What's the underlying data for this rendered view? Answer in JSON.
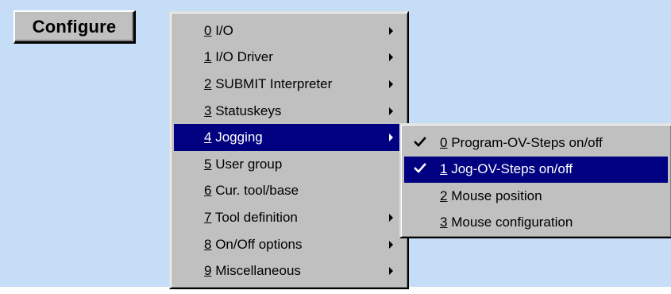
{
  "configure_button": {
    "label": "Configure"
  },
  "main_menu": {
    "items": [
      {
        "key": "0",
        "label": "I/O",
        "submenu": true
      },
      {
        "key": "1",
        "label": "I/O Driver",
        "submenu": true
      },
      {
        "key": "2",
        "label": "SUBMIT Interpreter",
        "submenu": true
      },
      {
        "key": "3",
        "label": "Statuskeys",
        "submenu": true
      },
      {
        "key": "4",
        "label": "Jogging",
        "submenu": true,
        "highlighted": true
      },
      {
        "key": "5",
        "label": "User group",
        "submenu": false
      },
      {
        "key": "6",
        "label": "Cur. tool/base",
        "submenu": false
      },
      {
        "key": "7",
        "label": "Tool definition",
        "submenu": true
      },
      {
        "key": "8",
        "label": "On/Off options",
        "submenu": true
      },
      {
        "key": "9",
        "label": "Miscellaneous",
        "submenu": true
      }
    ]
  },
  "jogging_submenu": {
    "items": [
      {
        "key": "0",
        "label": "Program-OV-Steps on/off",
        "checked": true
      },
      {
        "key": "1",
        "label": "Jog-OV-Steps on/off",
        "checked": true,
        "highlighted": true
      },
      {
        "key": "2",
        "label": "Mouse position",
        "checked": false
      },
      {
        "key": "3",
        "label": "Mouse configuration",
        "checked": false
      }
    ]
  },
  "colors": {
    "desktop": "#c6ddf7",
    "menu_face": "#c0c0c0",
    "highlight": "#000080",
    "highlight_text": "#ffffff"
  },
  "icons": {
    "submenu_arrow": "triangle-right",
    "check": "check-mark"
  }
}
